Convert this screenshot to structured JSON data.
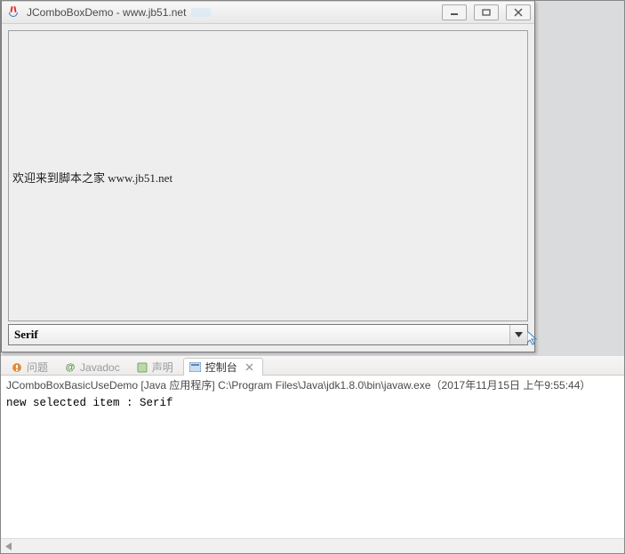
{
  "window": {
    "title": "JComboBoxDemo - www.jb51.net",
    "min_icon": "minimize-icon",
    "max_icon": "maximize-icon",
    "close_icon": "close-icon"
  },
  "panel": {
    "label_text": "欢迎来到脚本之家 www.jb51.net"
  },
  "combo": {
    "selected": "Serif"
  },
  "eclipse_tabs": {
    "problems": {
      "label": "问题"
    },
    "javadoc": {
      "label": "Javadoc"
    },
    "decl": {
      "label": "声明"
    },
    "console": {
      "label": "控制台"
    }
  },
  "console": {
    "header": "JComboBoxBasicUseDemo [Java 应用程序] C:\\Program Files\\Java\\jdk1.8.0\\bin\\javaw.exe（2017年11月15日 上午9:55:44）",
    "output": "new selected item : Serif"
  },
  "chart_data": null
}
